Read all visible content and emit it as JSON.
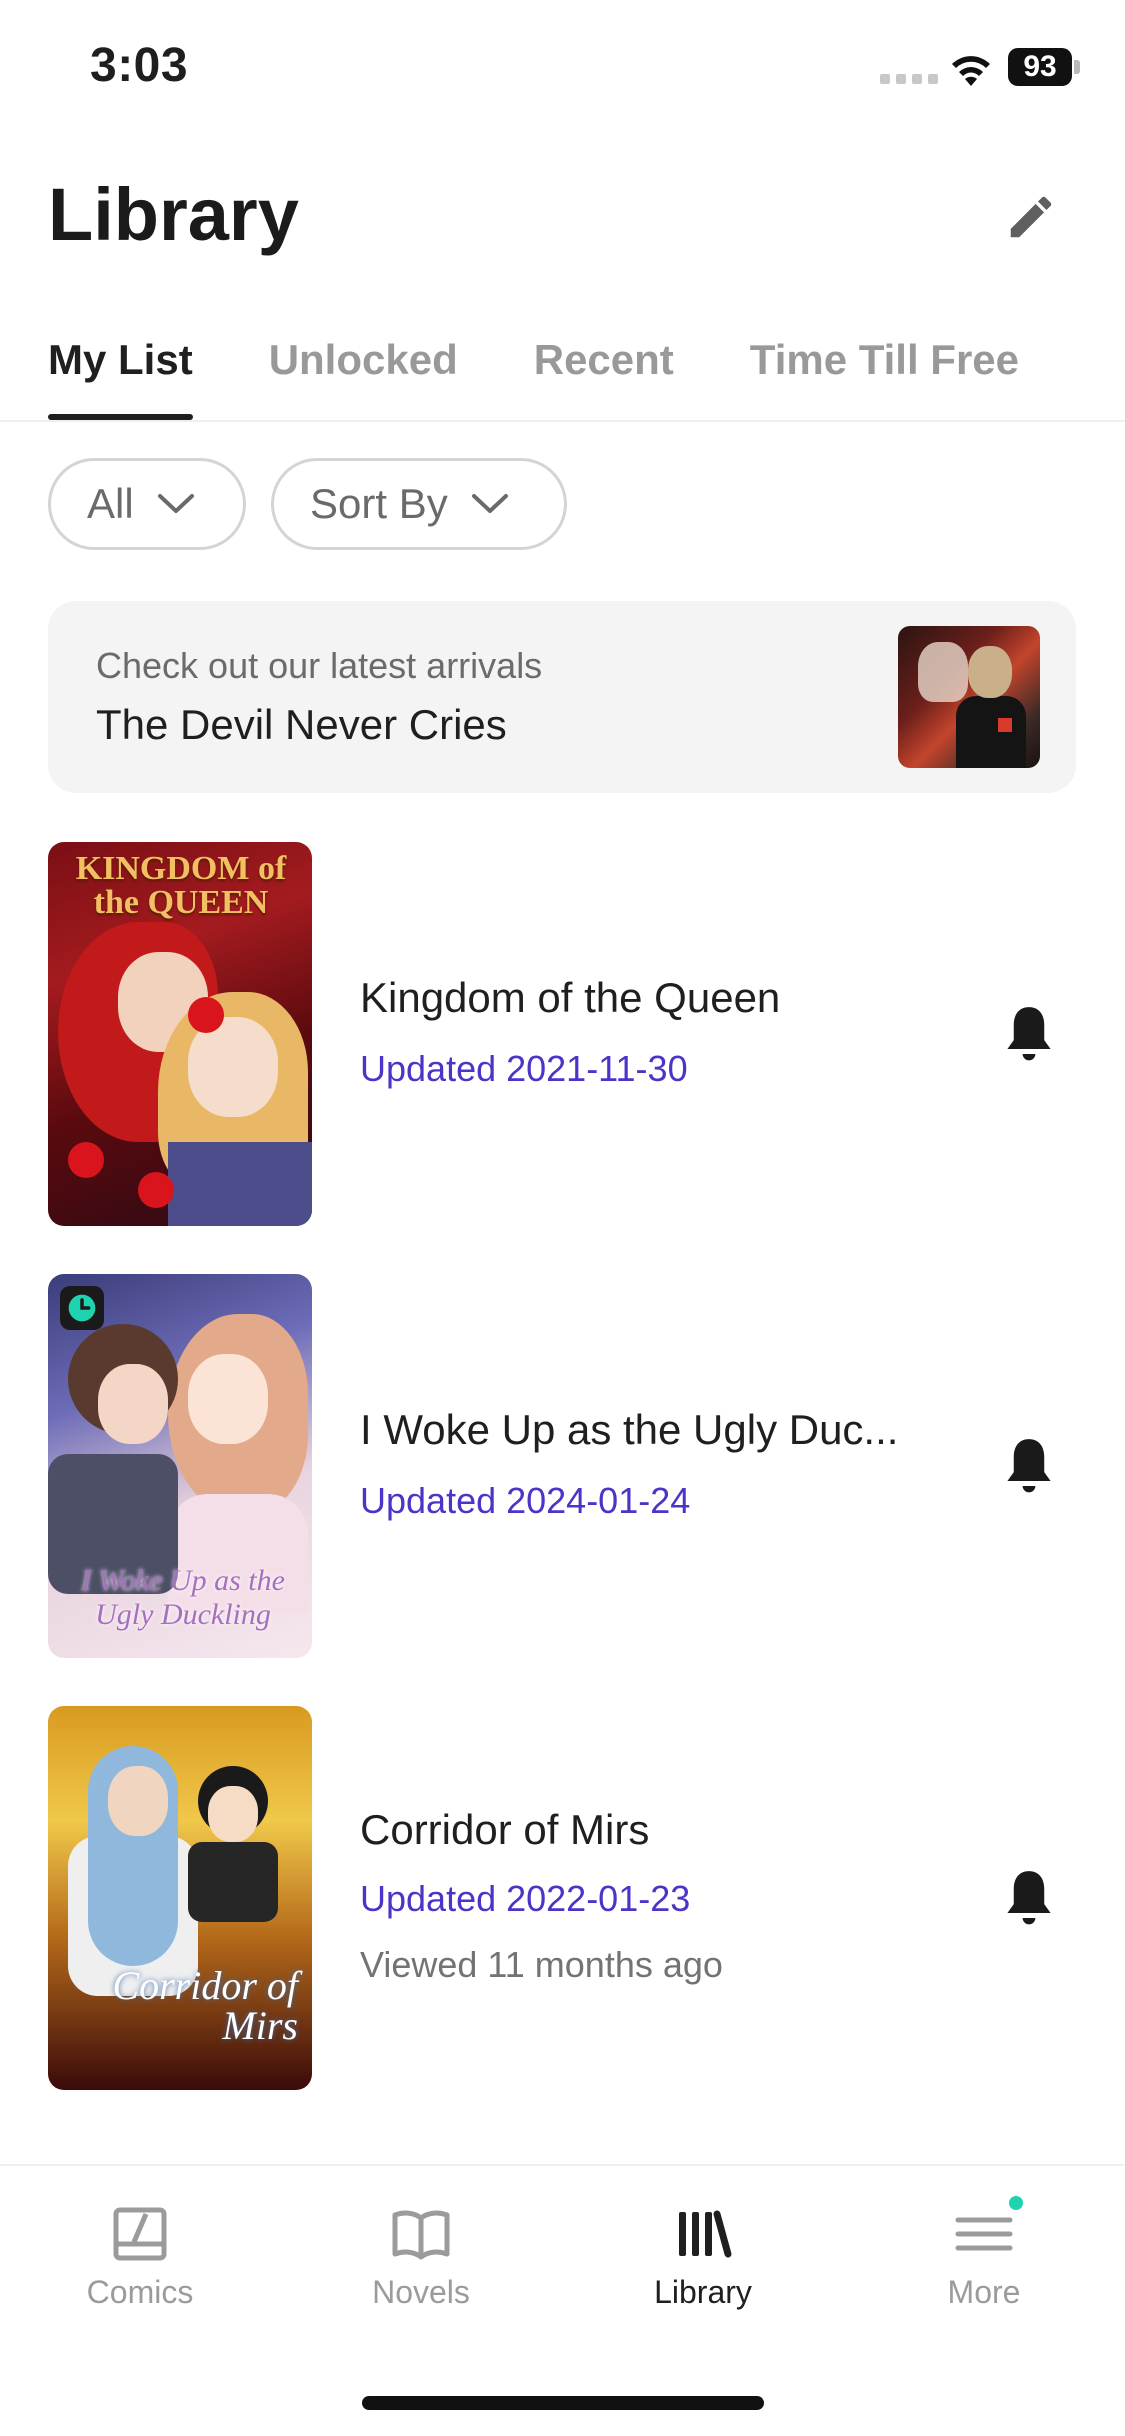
{
  "status_bar": {
    "time": "3:03",
    "battery": "93"
  },
  "header": {
    "title": "Library",
    "edit_icon": "pencil-icon"
  },
  "tabs": [
    {
      "label": "My List",
      "active": true
    },
    {
      "label": "Unlocked",
      "active": false
    },
    {
      "label": "Recent",
      "active": false
    },
    {
      "label": "Time Till Free",
      "active": false
    }
  ],
  "filters": {
    "all_label": "All",
    "sort_label": "Sort By"
  },
  "promo": {
    "subtitle": "Check out our latest arrivals",
    "title": "The Devil Never Cries"
  },
  "comics": [
    {
      "title": "Kingdom of the Queen",
      "updated": "Updated 2021-11-30",
      "viewed": "",
      "cover_text": "KINGDOM of the QUEEN"
    },
    {
      "title": "I Woke Up as the Ugly Duc...",
      "updated": "Updated 2024-01-24",
      "viewed": "",
      "cover_text": "I Woke Up as the Ugly Duckling"
    },
    {
      "title": "Corridor of Mirs",
      "updated": "Updated 2022-01-23",
      "viewed": "Viewed 11 months ago",
      "cover_text": "Corridor of Mirs"
    }
  ],
  "bottom_nav": [
    {
      "label": "Comics",
      "icon": "comics-icon",
      "active": false
    },
    {
      "label": "Novels",
      "icon": "book-icon",
      "active": false
    },
    {
      "label": "Library",
      "icon": "library-icon",
      "active": true
    },
    {
      "label": "More",
      "icon": "menu-icon",
      "active": false
    }
  ],
  "colors": {
    "accent": "#4a35c8",
    "badge_dot": "#20d3b0",
    "text": "#1f1f1f",
    "muted": "#999999"
  }
}
